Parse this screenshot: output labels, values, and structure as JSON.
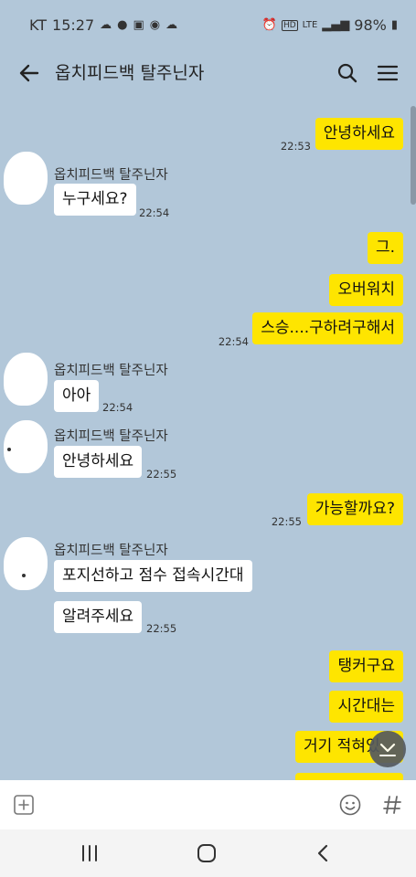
{
  "status_bar": {
    "carrier": "KT",
    "time": "15:27",
    "battery": "98%",
    "icons_left": [
      "cloud-icon",
      "food-icon",
      "image-icon",
      "talk-icon",
      "cloud-icon"
    ],
    "icons_right": [
      "alarm-icon",
      "hd-icon",
      "lte-icon",
      "signal-icon",
      "battery-icon"
    ]
  },
  "header": {
    "title": "옵치피드백 탈주닌자"
  },
  "chat": {
    "sender_name": "옵치피드백 탈주닌자",
    "messages": [
      {
        "text": "안녕하세요",
        "time": "22:53"
      },
      {
        "text": "누구세요?",
        "time": "22:54"
      },
      {
        "text": "그."
      },
      {
        "text": "오버워치"
      },
      {
        "text": "스승....구하려구해서",
        "time": "22:54"
      },
      {
        "text": "아아",
        "time": "22:54"
      },
      {
        "text": "안녕하세요",
        "time": "22:55"
      },
      {
        "text": "가능할까요?",
        "time": "22:55"
      },
      {
        "text": "포지선하고 점수 접속시간대"
      },
      {
        "text": "알려주세요",
        "time": "22:55"
      },
      {
        "text": "탱커구요"
      },
      {
        "text": "시간대는"
      },
      {
        "text": "거기 적혀있"
      }
    ]
  },
  "colors": {
    "chat_background": "#b2c7d9",
    "my_bubble": "#fee500",
    "their_bubble": "#ffffff"
  }
}
